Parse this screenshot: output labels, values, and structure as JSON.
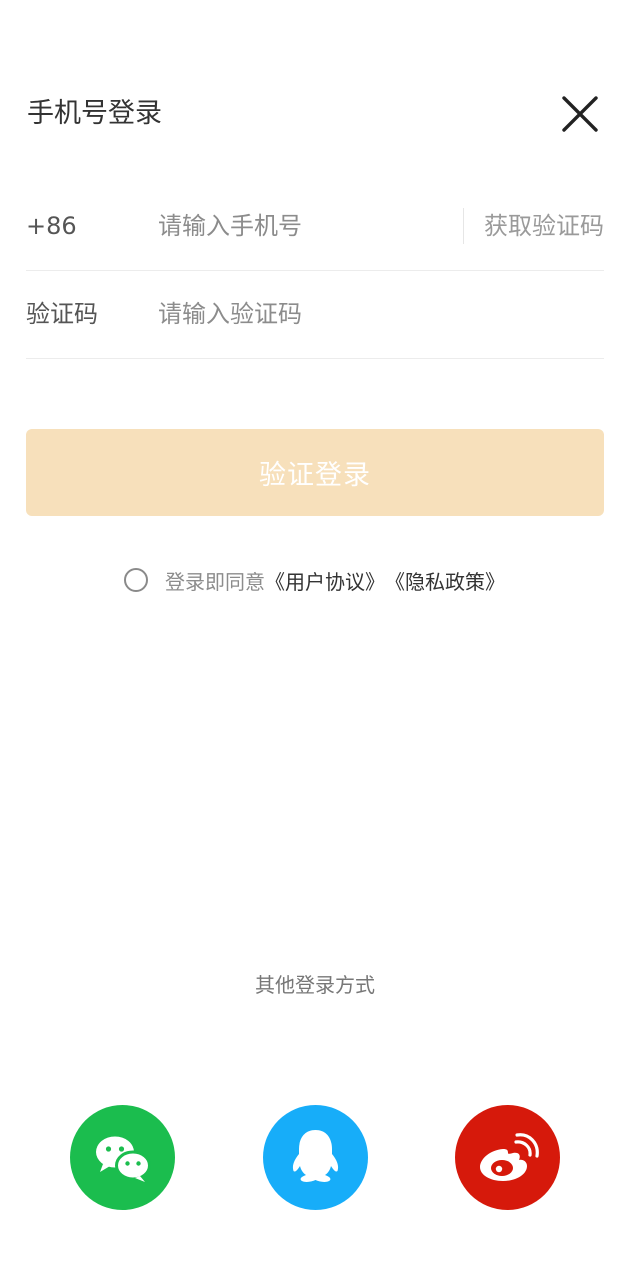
{
  "header": {
    "title": "手机号登录",
    "close_icon": "close-icon"
  },
  "phone_row": {
    "country_code": "+86",
    "placeholder": "请输入手机号",
    "value": "",
    "get_code_label": "获取验证码"
  },
  "code_row": {
    "label": "验证码",
    "placeholder": "请输入验证码",
    "value": ""
  },
  "submit": {
    "label": "验证登录",
    "color": "#f7e0bb"
  },
  "agreement": {
    "checked": false,
    "text": "登录即同意",
    "user_agreement": "《用户协议》",
    "privacy_policy": "《隐私政策》"
  },
  "other_login": {
    "title": "其他登录方式",
    "methods": [
      {
        "name": "wechat",
        "icon": "wechat-icon",
        "color": "#1bbd4e"
      },
      {
        "name": "qq",
        "icon": "qq-icon",
        "color": "#17adf9"
      },
      {
        "name": "weibo",
        "icon": "weibo-icon",
        "color": "#d6190b"
      }
    ]
  }
}
